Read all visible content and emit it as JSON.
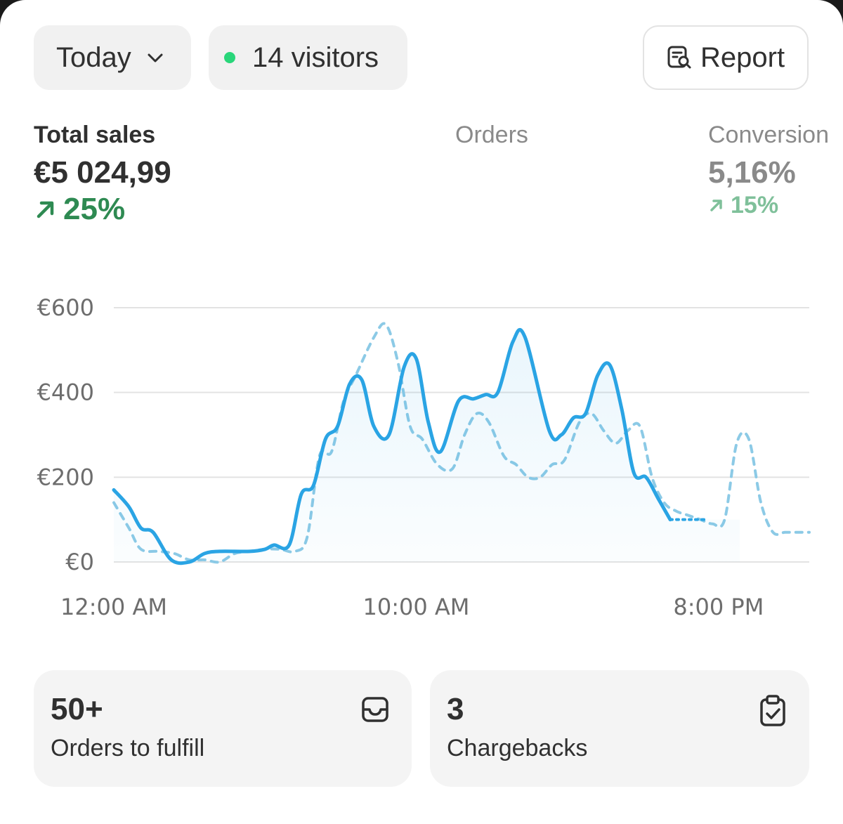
{
  "filters": {
    "date_range": "Today",
    "visitors_label": "14 visitors"
  },
  "report_button": "Report",
  "metrics": {
    "total_sales": {
      "label": "Total sales",
      "value": "€5 024,99",
      "change": "25%"
    },
    "orders": {
      "label": "Orders"
    },
    "conversion": {
      "label": "Conversion",
      "value": "5,16%",
      "change": "15%"
    }
  },
  "colors": {
    "current_series": "#2aa4e4",
    "comparison_series": "#8ccae6",
    "positive": "#2e8a52",
    "live_dot": "#29d67a"
  },
  "icons": {
    "date": "chevron-down-icon",
    "report": "report-search-icon",
    "change_up": "arrow-up-right-icon",
    "orders_tile": "inbox-icon",
    "chargebacks_tile": "clipboard-check-icon"
  },
  "chart_data": {
    "type": "line",
    "xlabel": "",
    "ylabel": "",
    "y_ticks": [
      "€600",
      "€400",
      "€200",
      "€0"
    ],
    "y_tick_values": [
      600,
      400,
      200,
      0
    ],
    "x_ticks": [
      "12:00 AM",
      "10:00 AM",
      "8:00 PM"
    ],
    "x_tick_hours": [
      0,
      10,
      20
    ],
    "ylim": [
      0,
      600
    ],
    "xlim": [
      0,
      23
    ],
    "grid": true,
    "series": [
      {
        "style": "solid",
        "x": [
          0,
          0.5,
          0.9,
          1.3,
          1.9,
          2.5,
          3.0,
          3.5,
          4.5,
          5.0,
          5.3,
          5.8,
          6.2,
          6.6,
          7.0,
          7.4,
          7.8,
          8.2,
          8.6,
          9.1,
          9.6,
          10.0,
          10.4,
          10.8,
          11.4,
          11.9,
          12.3,
          12.7,
          13.2,
          13.6,
          14.4,
          14.8,
          15.2,
          15.6,
          16.0,
          16.4,
          16.8,
          17.2,
          17.6,
          18.0,
          18.4,
          18.8,
          19.2,
          19.6,
          20.0,
          20.3,
          20.7
        ],
        "values": [
          170,
          130,
          80,
          70,
          5,
          0,
          20,
          25,
          25,
          30,
          40,
          40,
          160,
          180,
          290,
          320,
          420,
          430,
          320,
          300,
          460,
          480,
          330,
          260,
          380,
          385,
          395,
          400,
          520,
          530,
          310,
          300,
          340,
          350,
          440,
          465,
          360,
          210,
          200,
          150,
          100,
          100,
          100,
          100,
          100,
          100,
          100
        ]
      },
      {
        "style": "dashed",
        "x": [
          0,
          0.5,
          0.9,
          1.5,
          2.0,
          2.5,
          3.0,
          3.5,
          4.0,
          4.5,
          5.0,
          5.5,
          6.0,
          6.4,
          6.8,
          7.2,
          7.6,
          8.0,
          8.6,
          9.0,
          9.4,
          9.8,
          10.2,
          10.7,
          11.2,
          11.6,
          12.0,
          12.4,
          12.9,
          13.3,
          13.7,
          14.1,
          14.5,
          14.9,
          15.4,
          15.8,
          16.2,
          16.6,
          17.0,
          17.4,
          17.8,
          18.2,
          18.6,
          19.0,
          19.4,
          19.8,
          20.2,
          20.6,
          21.0,
          21.4,
          21.8,
          22.2,
          22.6,
          23.0
        ],
        "values": [
          140,
          80,
          30,
          25,
          20,
          5,
          5,
          0,
          20,
          25,
          30,
          30,
          25,
          60,
          250,
          260,
          380,
          440,
          530,
          560,
          470,
          320,
          290,
          230,
          220,
          300,
          350,
          330,
          250,
          230,
          200,
          200,
          230,
          240,
          330,
          350,
          310,
          280,
          310,
          320,
          200,
          140,
          120,
          110,
          100,
          90,
          100,
          280,
          290,
          140,
          70,
          70,
          70,
          70
        ]
      }
    ]
  },
  "tiles": [
    {
      "count": "50+",
      "label": "Orders to fulfill"
    },
    {
      "count": "3",
      "label": "Chargebacks"
    }
  ]
}
